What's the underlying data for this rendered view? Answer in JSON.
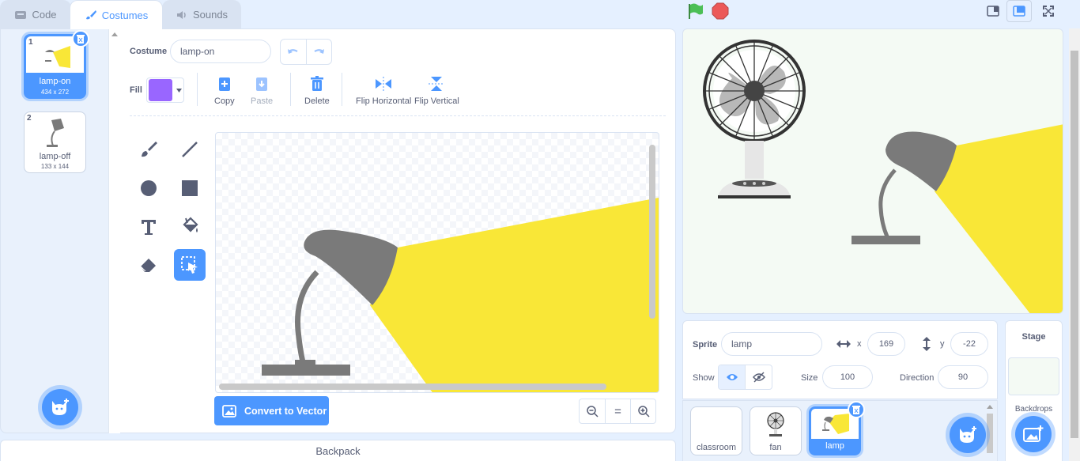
{
  "tabs": [
    {
      "label": "Code",
      "icon": "code-icon"
    },
    {
      "label": "Costumes",
      "icon": "brush-icon"
    },
    {
      "label": "Sounds",
      "icon": "speaker-icon"
    }
  ],
  "costumes": [
    {
      "number": "1",
      "name": "lamp-on",
      "dims": "434 x 272"
    },
    {
      "number": "2",
      "name": "lamp-off",
      "dims": "133 x 144"
    }
  ],
  "editor": {
    "costume_label": "Costume",
    "costume_name": "lamp-on",
    "fill_label": "Fill",
    "fill_color": "#9966ff",
    "copy": "Copy",
    "paste": "Paste",
    "delete": "Delete",
    "flip_h": "Flip Horizontal",
    "flip_v": "Flip Vertical",
    "convert": "Convert to Vector",
    "zoom_reset": "="
  },
  "backpack": "Backpack",
  "sprite": {
    "label": "Sprite",
    "name": "lamp",
    "x_label": "x",
    "x": "169",
    "y_label": "y",
    "y": "-22",
    "show_label": "Show",
    "size_label": "Size",
    "size": "100",
    "direction_label": "Direction",
    "direction": "90"
  },
  "sprites": [
    {
      "name": "classroom"
    },
    {
      "name": "fan"
    },
    {
      "name": "lamp"
    }
  ],
  "stage_panel": {
    "title": "Stage",
    "backdrops": "Backdrops"
  },
  "colors": {
    "accent": "#4c97ff",
    "lamp_body": "#7a7a7a",
    "light": "#f9e737",
    "green_flag": "#4cbf56",
    "stop": "#ec5959"
  }
}
